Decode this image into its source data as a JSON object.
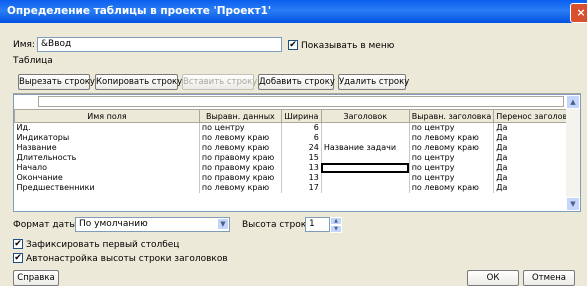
{
  "window": {
    "title": "Определение таблицы в проекте 'Проект1'",
    "close_glyph": "×"
  },
  "name_field": {
    "label": "Имя:",
    "value": "&Ввод"
  },
  "show_in_menu": {
    "label": "Показывать в меню",
    "checked": true
  },
  "table_group_label": "Таблица",
  "toolbar": {
    "cut_row": "Вырезать строку",
    "copy_row": "Копировать строку",
    "paste_row": "Вставить строку",
    "add_row": "Добавить строку",
    "delete_row": "Удалить строку"
  },
  "grid": {
    "headers": [
      "Имя поля",
      "Выравн. данных",
      "Ширина",
      "Заголовок",
      "Выравн. заголовка",
      "Перенос заголовка"
    ],
    "rows": [
      [
        "Ид.",
        "по центру",
        "6",
        "",
        "по центру",
        "Да"
      ],
      [
        "Индикаторы",
        "по левому краю",
        "6",
        "",
        "по левому краю",
        "Да"
      ],
      [
        "Название",
        "по левому краю",
        "24",
        "Название задачи",
        "по левому краю",
        "Да"
      ],
      [
        "Длительность",
        "по правому краю",
        "15",
        "",
        "по центру",
        "Да"
      ],
      [
        "Начало",
        "по правому краю",
        "13",
        "",
        "по центру",
        "Да"
      ],
      [
        "Окончание",
        "по правому краю",
        "13",
        "",
        "по центру",
        "Да"
      ],
      [
        "Предшественники",
        "по левому краю",
        "17",
        "",
        "по левому краю",
        "Да"
      ]
    ]
  },
  "date_format": {
    "label": "Формат даты:",
    "value": "По умолчанию"
  },
  "row_height": {
    "label": "Высота строк:",
    "value": "1"
  },
  "lock_first_column": {
    "label": "Зафиксировать первый столбец",
    "checked": true
  },
  "autofit_header": {
    "label": "Автонастройка высоты строки заголовков",
    "checked": true
  },
  "footer": {
    "help": "Справка",
    "ok": "ОК",
    "cancel": "Отмена"
  },
  "check_glyph": "✔"
}
